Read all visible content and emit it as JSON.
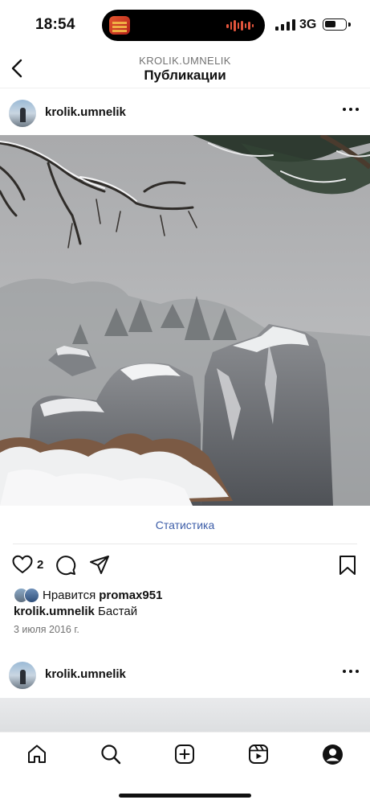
{
  "status_bar": {
    "time": "18:54",
    "network": "3G",
    "battery_level": 0.55,
    "island_app_icon": "music-app-icon"
  },
  "header": {
    "account": "KROLIK.UMNELIK",
    "title": "Публикации",
    "back_icon": "chevron-left-icon"
  },
  "post": {
    "username": "krolik.umnelik",
    "more_icon": "more-horizontal-icon",
    "photo_icon": "snowy-rocks-photo",
    "stats_label": "Статистика",
    "like_count": "2",
    "likes_prefix": "Нравится",
    "liked_by": "promax951",
    "caption_user": "krolik.umnelik",
    "caption_text": "Бастай",
    "date": "3 июля 2016 г."
  },
  "next_post": {
    "username": "krolik.umnelik"
  },
  "nav": {
    "items": [
      {
        "name": "home",
        "icon": "home-icon"
      },
      {
        "name": "search",
        "icon": "search-icon"
      },
      {
        "name": "create",
        "icon": "plus-square-icon"
      },
      {
        "name": "reels",
        "icon": "reels-icon"
      },
      {
        "name": "profile",
        "icon": "profile-icon"
      }
    ]
  },
  "colors": {
    "link": "#3c5da8",
    "muted": "#737373",
    "text": "#111111"
  }
}
